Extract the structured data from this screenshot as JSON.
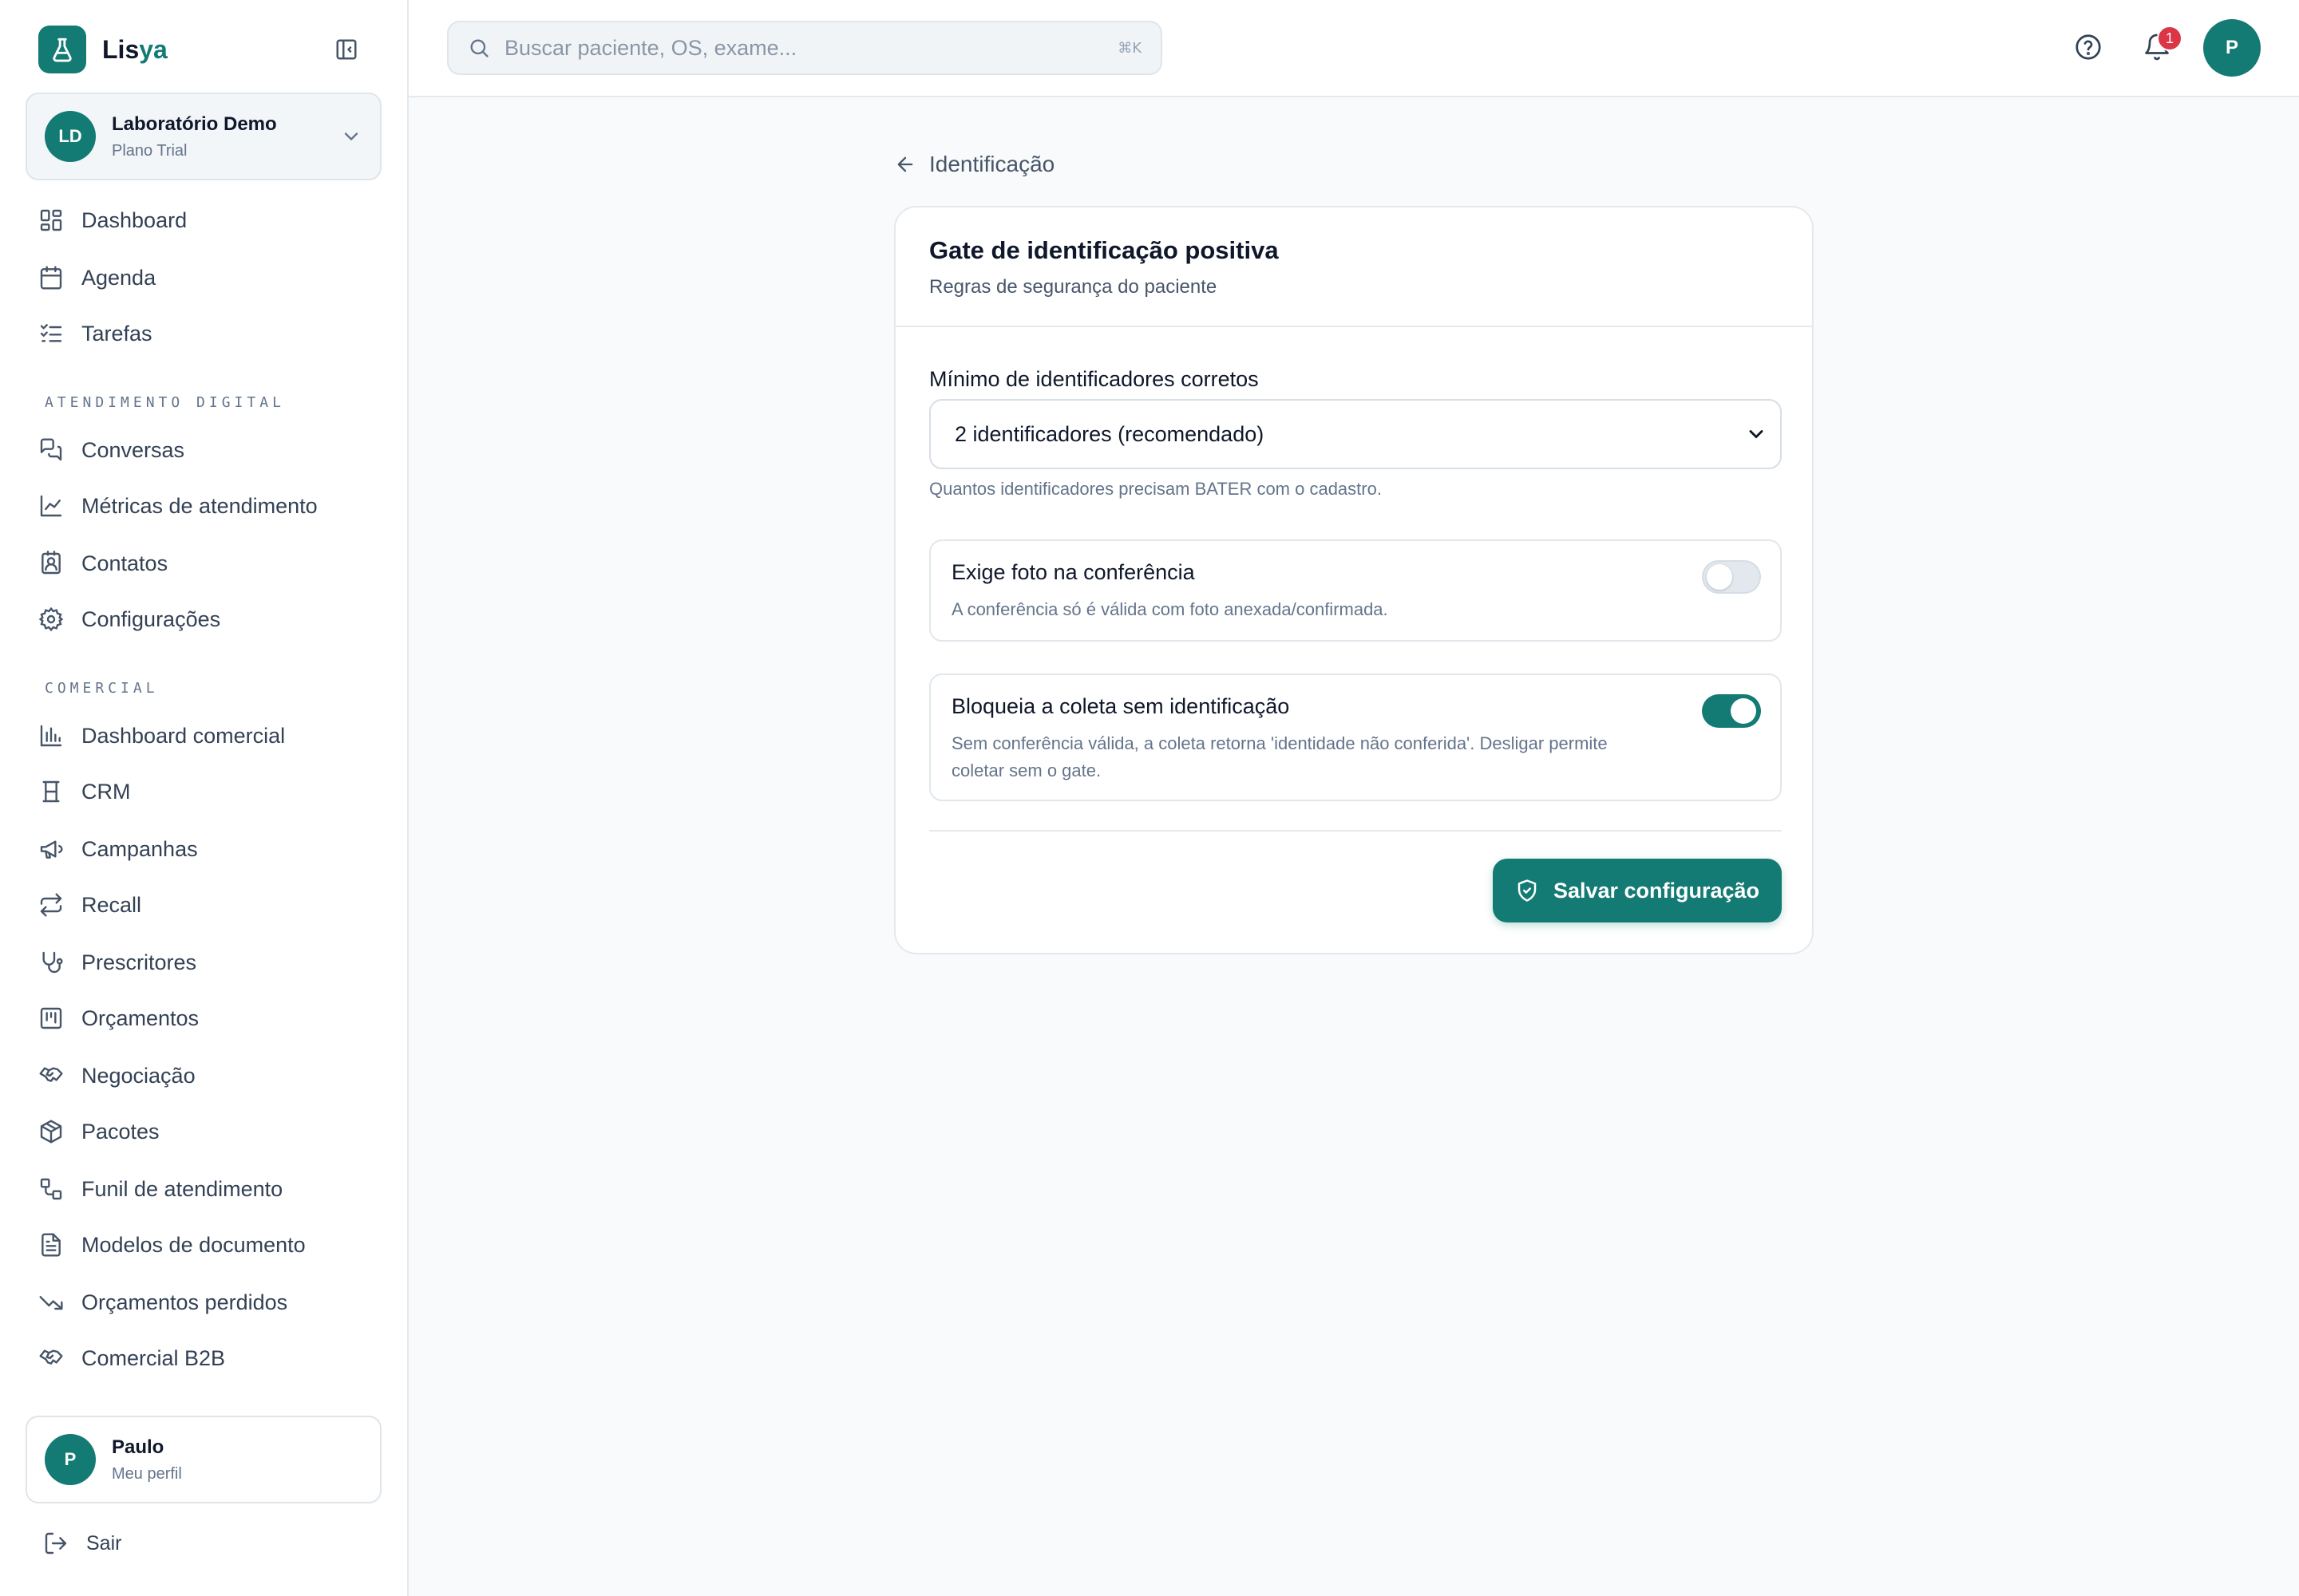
{
  "brand": {
    "name_part1": "Lis",
    "name_part2": "ya"
  },
  "org": {
    "initials": "LD",
    "name": "Laboratório Demo",
    "plan": "Plano Trial"
  },
  "nav": {
    "main": [
      {
        "label": "Dashboard",
        "icon": "dashboard-icon"
      },
      {
        "label": "Agenda",
        "icon": "calendar-icon"
      },
      {
        "label": "Tarefas",
        "icon": "tasks-icon"
      }
    ],
    "section_digital": "ATENDIMENTO DIGITAL",
    "digital": [
      {
        "label": "Conversas",
        "icon": "chat-icon"
      },
      {
        "label": "Métricas de atendimento",
        "icon": "line-chart-icon"
      },
      {
        "label": "Contatos",
        "icon": "contacts-icon"
      },
      {
        "label": "Configurações",
        "icon": "gear-icon"
      }
    ],
    "section_comercial": "COMERCIAL",
    "comercial": [
      {
        "label": "Dashboard comercial",
        "icon": "bar-chart-icon"
      },
      {
        "label": "CRM",
        "icon": "crm-icon"
      },
      {
        "label": "Campanhas",
        "icon": "megaphone-icon"
      },
      {
        "label": "Recall",
        "icon": "repeat-icon"
      },
      {
        "label": "Prescritores",
        "icon": "stethoscope-icon"
      },
      {
        "label": "Orçamentos",
        "icon": "kanban-icon"
      },
      {
        "label": "Negociação",
        "icon": "handshake-icon"
      },
      {
        "label": "Pacotes",
        "icon": "package-icon"
      },
      {
        "label": "Funil de atendimento",
        "icon": "workflow-icon"
      },
      {
        "label": "Modelos de documento",
        "icon": "document-icon"
      },
      {
        "label": "Orçamentos perdidos",
        "icon": "trending-down-icon"
      },
      {
        "label": "Comercial B2B",
        "icon": "handshake-icon"
      }
    ]
  },
  "profile": {
    "initial": "P",
    "name": "Paulo",
    "sub": "Meu perfil"
  },
  "logout_label": "Sair",
  "topbar": {
    "search_placeholder": "Buscar paciente, OS, exame...",
    "shortcut": "⌘K",
    "notifications_count": "1",
    "user_initial": "P"
  },
  "page": {
    "back_label": "Identificação",
    "card_title": "Gate de identificação positiva",
    "card_subtitle": "Regras de segurança do paciente",
    "min_label": "Mínimo de identificadores corretos",
    "min_selected": "2 identificadores (recomendado)",
    "min_hint": "Quantos identificadores precisam BATER com o cadastro.",
    "photo": {
      "title": "Exige foto na conferência",
      "desc": "A conferência só é válida com foto anexada/confirmada.",
      "enabled": false
    },
    "block": {
      "title": "Bloqueia a coleta sem identificação",
      "desc": "Sem conferência válida, a coleta retorna 'identidade não conferida'. Desligar permite coletar sem o gate.",
      "enabled": true
    },
    "save_label": "Salvar configuração"
  },
  "colors": {
    "accent": "#137a74",
    "badge": "#dc3545"
  }
}
